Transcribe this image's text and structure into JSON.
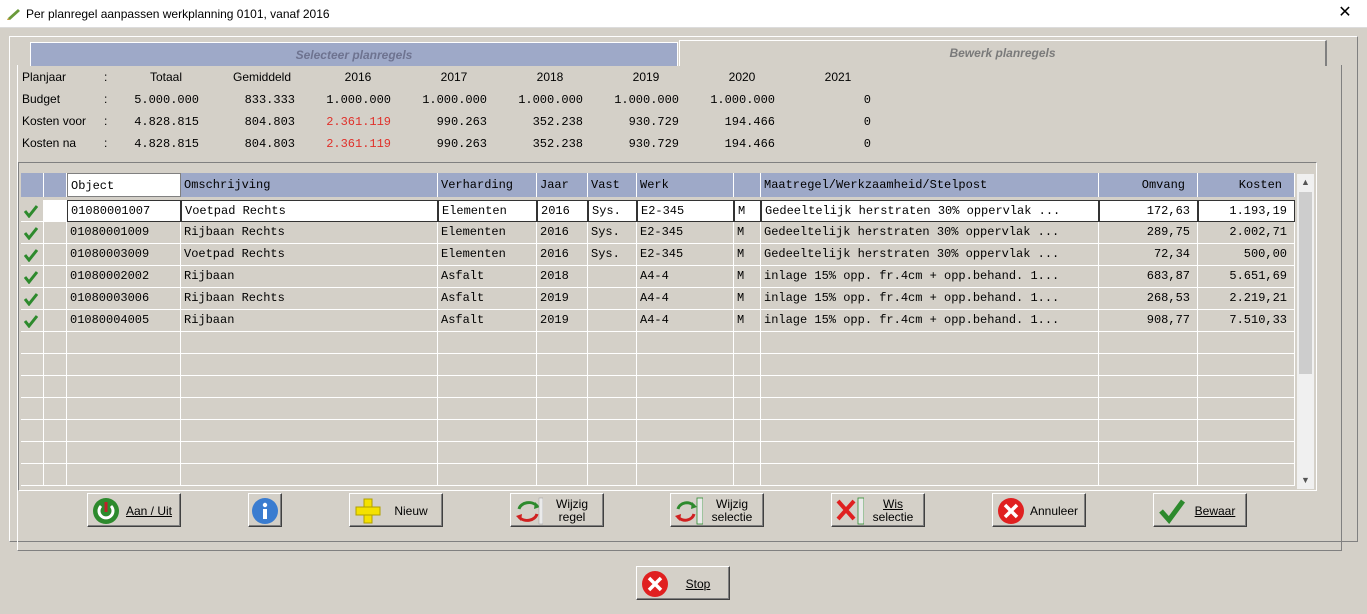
{
  "window": {
    "title": "Per planregel aanpassen werkplanning 0101, vanaf 2016",
    "close_glyph": "✕"
  },
  "tabs": {
    "select_label": "Selecteer planregels",
    "edit_label": "Bewerk planregels"
  },
  "summary": {
    "header": [
      "Planjaar",
      ":",
      "Totaal",
      "Gemiddeld",
      "2016",
      "2017",
      "2018",
      "2019",
      "2020",
      "2021"
    ],
    "rows": [
      {
        "label": "Budget",
        "colon": ":",
        "values": [
          "5.000.000",
          "833.333",
          "1.000.000",
          "1.000.000",
          "1.000.000",
          "1.000.000",
          "1.000.000",
          "0"
        ]
      },
      {
        "label": "Kosten voor",
        "colon": ":",
        "values": [
          "4.828.815",
          "804.803",
          "2.361.119",
          "990.263",
          "352.238",
          "930.729",
          "194.466",
          "0"
        ]
      },
      {
        "label": "Kosten na",
        "colon": ":",
        "values": [
          "4.828.815",
          "804.803",
          "2.361.119",
          "990.263",
          "352.238",
          "930.729",
          "194.466",
          "0"
        ]
      }
    ],
    "highlight_color": "#e0302a"
  },
  "grid": {
    "headers": [
      "",
      "",
      "Object",
      "Omschrijving",
      "Verharding",
      "Jaar",
      "Vast",
      "Werk",
      "",
      "Maatregel/Werkzaamheid/Stelpost",
      "Omvang",
      "Kosten"
    ],
    "rows": [
      {
        "object": "01080001007",
        "omschrijving": "Voetpad Rechts",
        "verharding": "Elementen",
        "jaar": "2016",
        "vast": "Sys.",
        "werk": "E2-345",
        "m": "M",
        "maatregel": "Gedeeltelijk herstraten 30% oppervlak ...",
        "omvang": "172,63",
        "kosten": "1.193,19"
      },
      {
        "object": "01080001009",
        "omschrijving": "Rijbaan Rechts",
        "verharding": "Elementen",
        "jaar": "2016",
        "vast": "Sys.",
        "werk": "E2-345",
        "m": "M",
        "maatregel": "Gedeeltelijk herstraten 30% oppervlak ...",
        "omvang": "289,75",
        "kosten": "2.002,71"
      },
      {
        "object": "01080003009",
        "omschrijving": "Voetpad Rechts",
        "verharding": "Elementen",
        "jaar": "2016",
        "vast": "Sys.",
        "werk": "E2-345",
        "m": "M",
        "maatregel": "Gedeeltelijk herstraten 30% oppervlak ...",
        "omvang": "72,34",
        "kosten": "500,00"
      },
      {
        "object": "01080002002",
        "omschrijving": "Rijbaan",
        "verharding": "Asfalt",
        "jaar": "2018",
        "vast": "",
        "werk": "A4-4",
        "m": "M",
        "maatregel": "inlage 15% opp. fr.4cm + opp.behand. 1...",
        "omvang": "683,87",
        "kosten": "5.651,69"
      },
      {
        "object": "01080003006",
        "omschrijving": "Rijbaan Rechts",
        "verharding": "Asfalt",
        "jaar": "2019",
        "vast": "",
        "werk": "A4-4",
        "m": "M",
        "maatregel": "inlage 15% opp. fr.4cm + opp.behand. 1...",
        "omvang": "268,53",
        "kosten": "2.219,21"
      },
      {
        "object": "01080004005",
        "omschrijving": "Rijbaan",
        "verharding": "Asfalt",
        "jaar": "2019",
        "vast": "",
        "werk": "A4-4",
        "m": "M",
        "maatregel": "inlage 15% opp. fr.4cm + opp.behand. 1...",
        "omvang": "908,77",
        "kosten": "7.510,33"
      }
    ],
    "empty_rows": 7,
    "header_color": "#9ea9c8"
  },
  "buttons": {
    "aan_uit": {
      "label": "Aan / Uit",
      "icon": "power-icon"
    },
    "info": {
      "label": "",
      "icon": "info-icon"
    },
    "nieuw": {
      "label": "Nieuw",
      "icon": "plus-icon"
    },
    "wijzig_regel": {
      "label1": "Wijzig",
      "label2": "regel",
      "icon": "refresh-row-icon"
    },
    "wijzig_selectie": {
      "label1": "Wijzig",
      "label2": "selectie",
      "icon": "refresh-selection-icon"
    },
    "wis_selectie": {
      "label1": "Wis",
      "label2": "selectie",
      "icon": "delete-selection-icon"
    },
    "annuleer": {
      "label": "Annuleer",
      "icon": "cancel-icon"
    },
    "bewaar": {
      "label": "Bewaar",
      "icon": "check-icon"
    },
    "stop": {
      "label": "Stop",
      "icon": "stop-icon"
    }
  }
}
